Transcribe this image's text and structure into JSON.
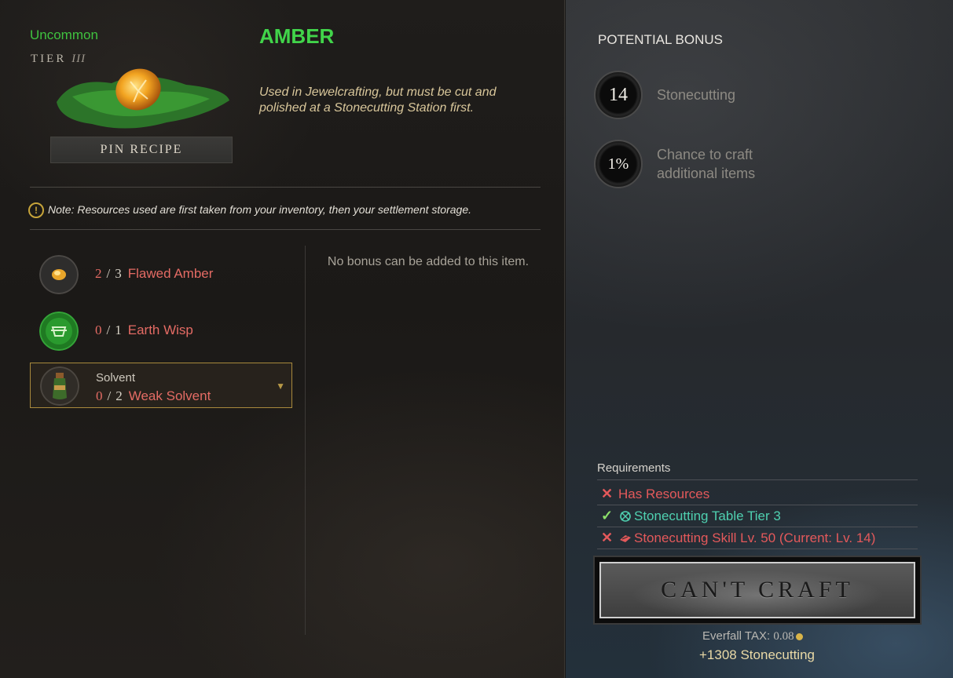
{
  "item": {
    "rarity": "Uncommon",
    "tier_word": "TIER",
    "tier_numeral": "III",
    "name": "AMBER",
    "description": "Used in Jewelcrafting, but must be cut and polished at a Stonecutting Station first.",
    "pin_label": "PIN RECIPE",
    "icon": "amber-gem-icon"
  },
  "note": {
    "icon": "warning-icon",
    "text": "Note: Resources used are first taken from your inventory, then your settlement storage."
  },
  "resources": [
    {
      "have": "2",
      "sep": "/",
      "need": "3",
      "name": "Flawed Amber",
      "icon": "flawed-amber-icon"
    },
    {
      "have": "0",
      "sep": "/",
      "need": "1",
      "name": "Earth Wisp",
      "icon": "earth-wisp-icon"
    },
    {
      "category": "Solvent",
      "have": "0",
      "sep": "/",
      "need": "2",
      "name": "Weak Solvent",
      "icon": "weak-solvent-icon",
      "selected": true
    }
  ],
  "no_bonus": "No bonus can be added to this item.",
  "potential_bonus": {
    "title": "POTENTIAL BONUS",
    "items": [
      {
        "value": "14",
        "label": "Stonecutting"
      },
      {
        "value": "1%",
        "label_line1": "Chance to craft",
        "label_line2": "additional items"
      }
    ]
  },
  "requirements": {
    "title": "Requirements",
    "items": [
      {
        "met": false,
        "text": "Has Resources"
      },
      {
        "met": true,
        "icon": "stonecutting-table-icon",
        "text": "Stonecutting Table Tier 3"
      },
      {
        "met": false,
        "icon": "stonecutting-skill-icon",
        "text": "Stonecutting Skill Lv. 50 (Current: Lv. 14)"
      }
    ]
  },
  "craft": {
    "button_label": "CAN'T CRAFT",
    "tax_label": "Everfall TAX:",
    "tax_value": "0.08",
    "xp_text": "+1308 Stonecutting"
  },
  "colors": {
    "rarity": "#3fc23f",
    "fail": "#e4595b",
    "ok": "#4fd0b0",
    "accent_gold": "#d9b449"
  }
}
